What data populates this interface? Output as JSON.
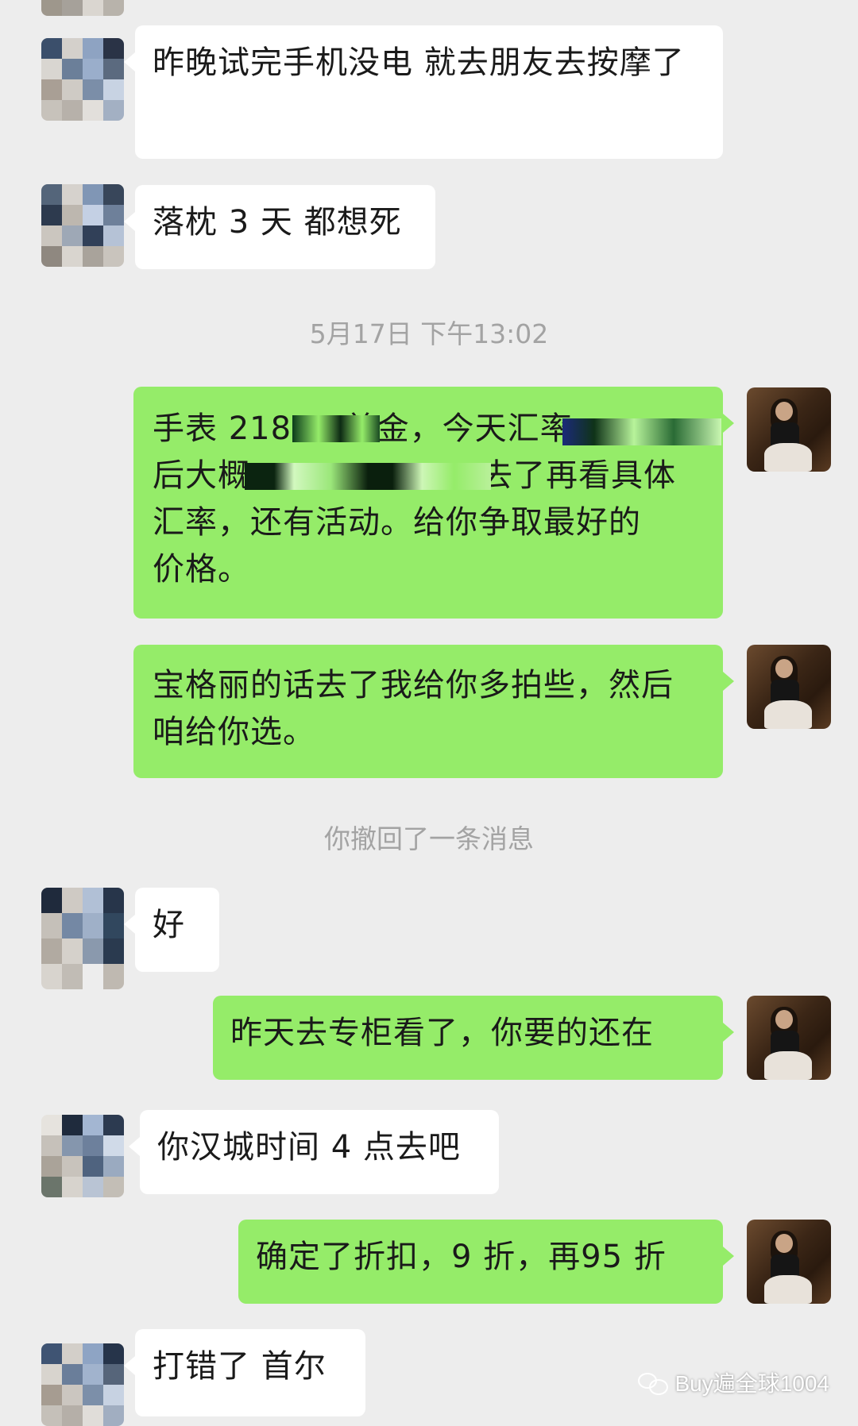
{
  "conversation": {
    "messages": [
      {
        "id": "m1",
        "side": "left",
        "text": "昨晚试完手机没电 就去朋友去按摩了"
      },
      {
        "id": "m2",
        "side": "left",
        "text": "落枕 3 天 都想死"
      },
      {
        "id": "t1",
        "type": "timestamp",
        "text": "5月17日 下午13:02"
      },
      {
        "id": "m3",
        "side": "right",
        "lines": [
          "手表 21800 美金，今天汇率",
          "后大概",
          "去了再看具体",
          "汇率，还有活动。给你争取最好的",
          "价格。"
        ]
      },
      {
        "id": "m4",
        "side": "right",
        "text": "宝格丽的话去了我给你多拍些，然后咱给你选。"
      },
      {
        "id": "r1",
        "type": "system",
        "text": "你撤回了一条消息"
      },
      {
        "id": "m5",
        "side": "left",
        "text": "好"
      },
      {
        "id": "m6",
        "side": "right",
        "text": "昨天去专柜看了，你要的还在"
      },
      {
        "id": "m7",
        "side": "left",
        "text": "你汉城时间 4 点去吧"
      },
      {
        "id": "m8",
        "side": "right",
        "text": "确定了折扣，9 折，再95 折"
      },
      {
        "id": "m9",
        "side": "left",
        "text": "打错了 首尔"
      }
    ]
  },
  "watermark": {
    "text": "Buy遍全球1004",
    "icon": "wechat-official-account-icon"
  },
  "colors": {
    "background": "#ededed",
    "left_bubble": "#ffffff",
    "right_bubble": "#95ec69",
    "system_text": "#a3a3a3"
  }
}
